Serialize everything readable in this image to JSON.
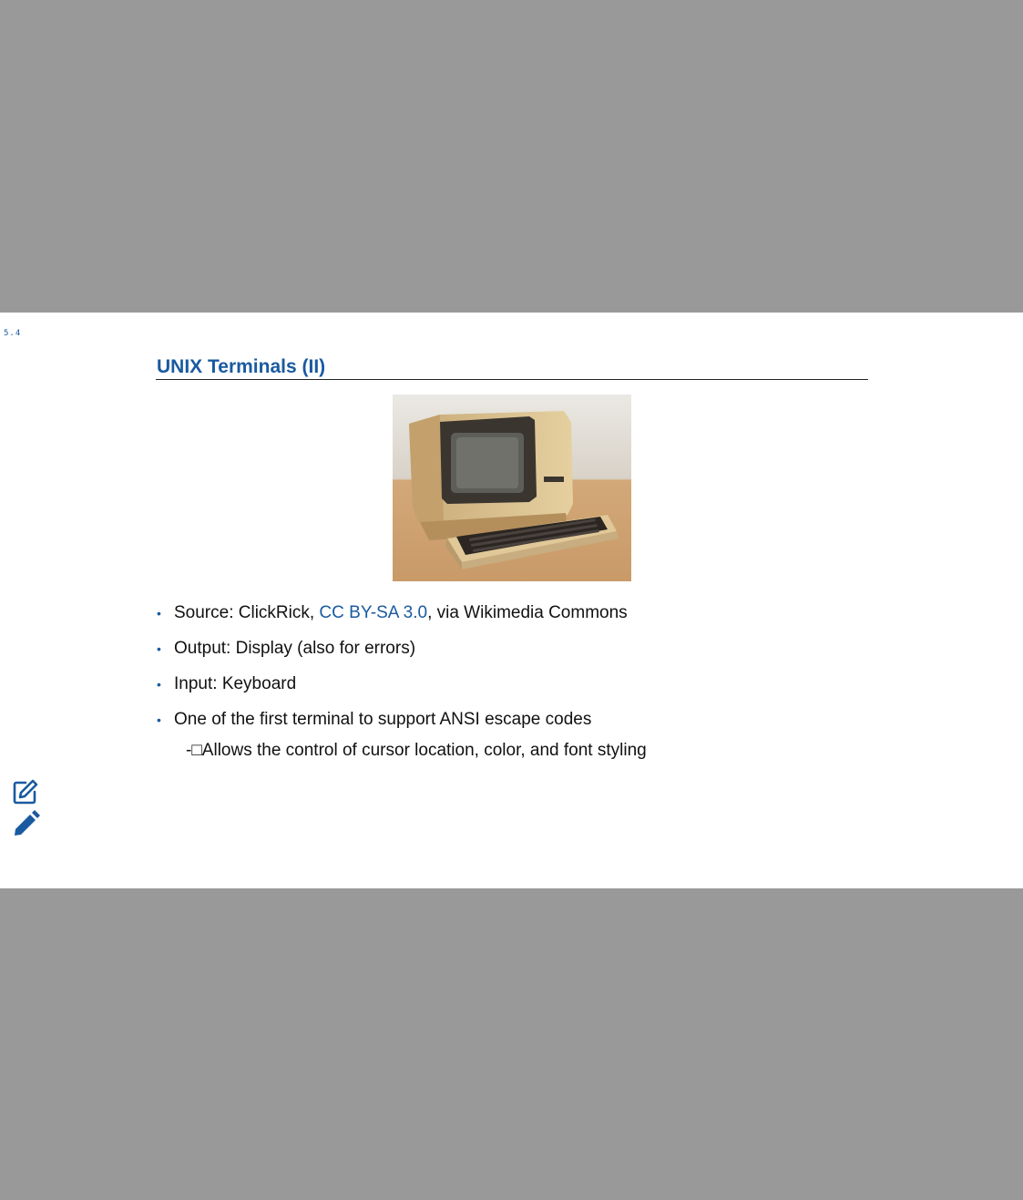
{
  "slide": {
    "number": "5.4",
    "title": "UNIX Terminals (II)",
    "bullets": {
      "source_prefix": "Source: ClickRick, ",
      "source_link": "CC BY-SA 3.0",
      "source_suffix": ", via Wikimedia Commons",
      "output": "Output: Display (also for errors)",
      "input": "Input: Keyboard",
      "ansi": "One of the first terminal to support ANSI escape codes"
    },
    "sub_bullet": "-□Allows the control of cursor location, color, and font styling"
  },
  "icons": {
    "edit_note": "edit-note-icon",
    "pencil": "pencil-icon"
  },
  "colors": {
    "accent": "#1a5aa0",
    "backdrop": "#999999"
  }
}
